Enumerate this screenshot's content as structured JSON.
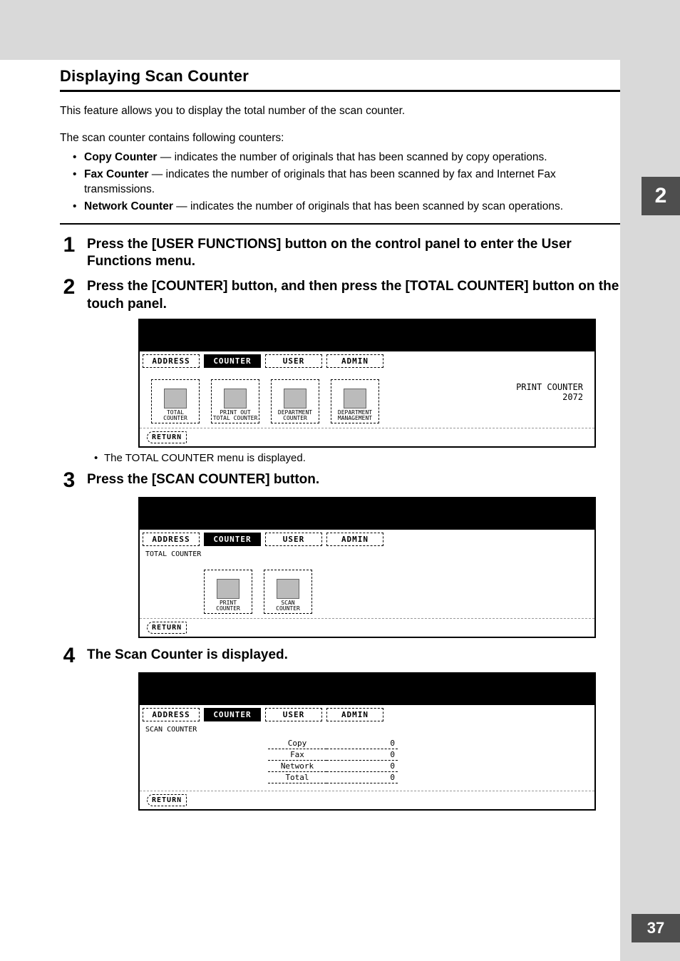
{
  "sectionTitle": "Displaying Scan Counter",
  "intro": "This feature allows you to display the total number of the scan counter.",
  "contains": "The scan counter contains following counters:",
  "bullets": {
    "b1": {
      "bold": "Copy Counter",
      "rest": " — indicates the number of originals that has been scanned by copy operations."
    },
    "b2": {
      "bold": "Fax Counter",
      "rest": " — indicates the number of originals that has been scanned by fax and Internet Fax transmissions."
    },
    "b3": {
      "bold": "Network Counter",
      "rest": " — indicates the number of originals that has been scanned by scan operations."
    }
  },
  "steps": {
    "s1": {
      "num": "1",
      "text": "Press the [USER FUNCTIONS] button on the control panel to enter the User Functions menu."
    },
    "s2": {
      "num": "2",
      "text": "Press the [COUNTER] button, and then press the [TOTAL COUNTER] button on the touch panel."
    },
    "s2note": "The TOTAL COUNTER menu is displayed.",
    "s3": {
      "num": "3",
      "text": "Press the [SCAN COUNTER] button."
    },
    "s4": {
      "num": "4",
      "text": "The Scan Counter is displayed."
    }
  },
  "panelTabs": {
    "address": "ADDRESS",
    "counter": "COUNTER",
    "user": "USER",
    "admin": "ADMIN"
  },
  "panelIcons1": {
    "i1": "TOTAL\nCOUNTER",
    "i2": "PRINT OUT\nTOTAL COUNTER",
    "i3": "DEPARTMENT\nCOUNTER",
    "i4": "DEPARTMENT\nMANAGEMENT"
  },
  "panelRight": {
    "label": "PRINT COUNTER",
    "value": "2072"
  },
  "panelReturn": "RETURN",
  "panel2Subtitle": "TOTAL COUNTER",
  "panelIcons2": {
    "i1": "PRINT\nCOUNTER",
    "i2": "SCAN\nCOUNTER"
  },
  "panel3Subtitle": "SCAN COUNTER",
  "scanTable": {
    "r1": {
      "k": "Copy",
      "v": "0"
    },
    "r2": {
      "k": "Fax",
      "v": "0"
    },
    "r3": {
      "k": "Network",
      "v": "0"
    },
    "r4": {
      "k": "Total",
      "v": "0"
    }
  },
  "chapterNum": "2",
  "pageNum": "37"
}
